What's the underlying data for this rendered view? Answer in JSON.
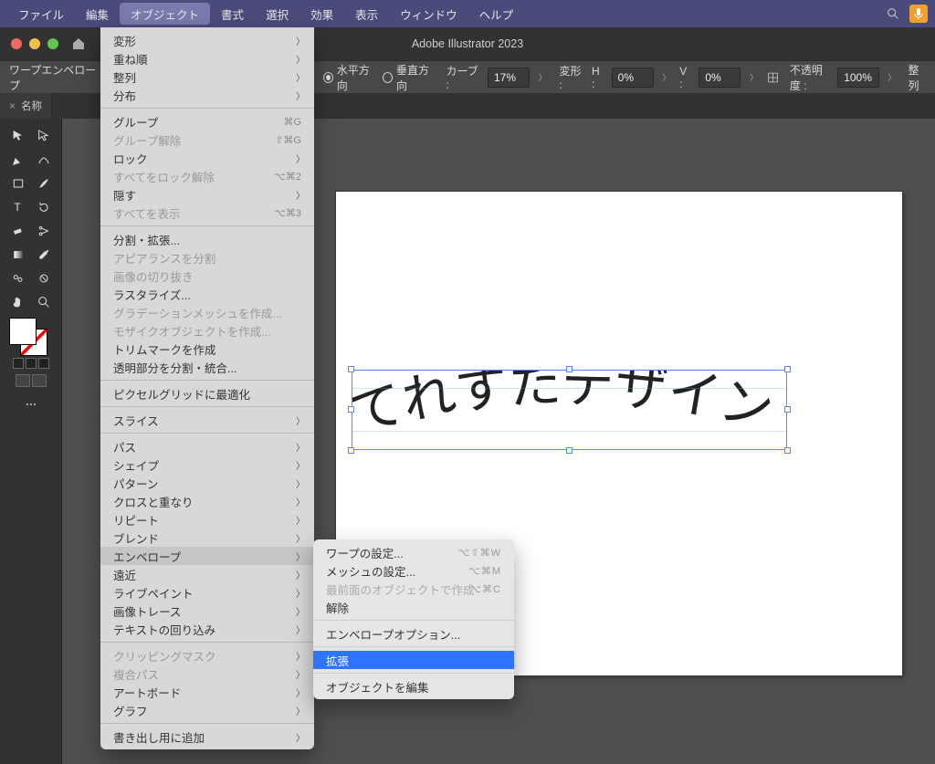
{
  "menubar": {
    "items": [
      "ファイル",
      "編集",
      "オブジェクト",
      "書式",
      "選択",
      "効果",
      "表示",
      "ウィンドウ",
      "ヘルプ"
    ],
    "open_index": 2
  },
  "app_title": "Adobe Illustrator 2023",
  "options": {
    "mode_label": "ワープエンベロープ",
    "radio_h": "水平方向",
    "radio_v": "垂直方向",
    "curve_label": "カーブ :",
    "curve_value": "17%",
    "deform_label": "変形 :",
    "deform_h_label": "H :",
    "deform_h_value": "0%",
    "deform_v_label": "V :",
    "deform_v_value": "0%",
    "opacity_label": "不透明度 :",
    "opacity_value": "100%",
    "align_label": "整列"
  },
  "tabs": {
    "items": [
      {
        "close": "×",
        "label": "名称"
      }
    ]
  },
  "canvas_text": "てれすたデザイン",
  "object_menu": [
    {
      "label": "変形",
      "sub": true
    },
    {
      "label": "重ね順",
      "sub": true
    },
    {
      "label": "整列",
      "sub": true
    },
    {
      "label": "分布",
      "sub": true
    },
    {
      "sep": true
    },
    {
      "label": "グループ",
      "kbd": "⌘G"
    },
    {
      "label": "グループ解除",
      "kbd": "⇧⌘G",
      "disabled": true
    },
    {
      "label": "ロック",
      "sub": true
    },
    {
      "label": "すべてをロック解除",
      "kbd": "⌥⌘2",
      "disabled": true
    },
    {
      "label": "隠す",
      "sub": true
    },
    {
      "label": "すべてを表示",
      "kbd": "⌥⌘3",
      "disabled": true
    },
    {
      "sep": true
    },
    {
      "label": "分割・拡張..."
    },
    {
      "label": "アピアランスを分割",
      "disabled": true
    },
    {
      "label": "画像の切り抜き",
      "disabled": true
    },
    {
      "label": "ラスタライズ..."
    },
    {
      "label": "グラデーションメッシュを作成...",
      "disabled": true
    },
    {
      "label": "モザイクオブジェクトを作成...",
      "disabled": true
    },
    {
      "label": "トリムマークを作成"
    },
    {
      "label": "透明部分を分割・統合..."
    },
    {
      "sep": true
    },
    {
      "label": "ピクセルグリッドに最適化"
    },
    {
      "sep": true
    },
    {
      "label": "スライス",
      "sub": true
    },
    {
      "sep": true
    },
    {
      "label": "パス",
      "sub": true
    },
    {
      "label": "シェイプ",
      "sub": true
    },
    {
      "label": "パターン",
      "sub": true
    },
    {
      "label": "クロスと重なり",
      "sub": true
    },
    {
      "label": "リピート",
      "sub": true
    },
    {
      "label": "ブレンド",
      "sub": true
    },
    {
      "label": "エンベロープ",
      "sub": true,
      "hover": true
    },
    {
      "label": "遠近",
      "sub": true
    },
    {
      "label": "ライブペイント",
      "sub": true
    },
    {
      "label": "画像トレース",
      "sub": true
    },
    {
      "label": "テキストの回り込み",
      "sub": true
    },
    {
      "sep": true
    },
    {
      "label": "クリッピングマスク",
      "sub": true,
      "disabled": true
    },
    {
      "label": "複合パス",
      "sub": true,
      "disabled": true
    },
    {
      "label": "アートボード",
      "sub": true
    },
    {
      "label": "グラフ",
      "sub": true
    },
    {
      "sep": true
    },
    {
      "label": "書き出し用に追加",
      "sub": true
    }
  ],
  "envelope_submenu": [
    {
      "label": "ワープの設定...",
      "kbd": "⌥⇧⌘W"
    },
    {
      "label": "メッシュの設定...",
      "kbd": "⌥⌘M"
    },
    {
      "label": "最前面のオブジェクトで作成",
      "kbd": "⌥⌘C",
      "disabled": true
    },
    {
      "label": "解除"
    },
    {
      "sep": true
    },
    {
      "label": "エンベロープオプション..."
    },
    {
      "sep": true
    },
    {
      "label": "拡張",
      "selected": true
    },
    {
      "sep": true
    },
    {
      "label": "オブジェクトを編集"
    }
  ]
}
